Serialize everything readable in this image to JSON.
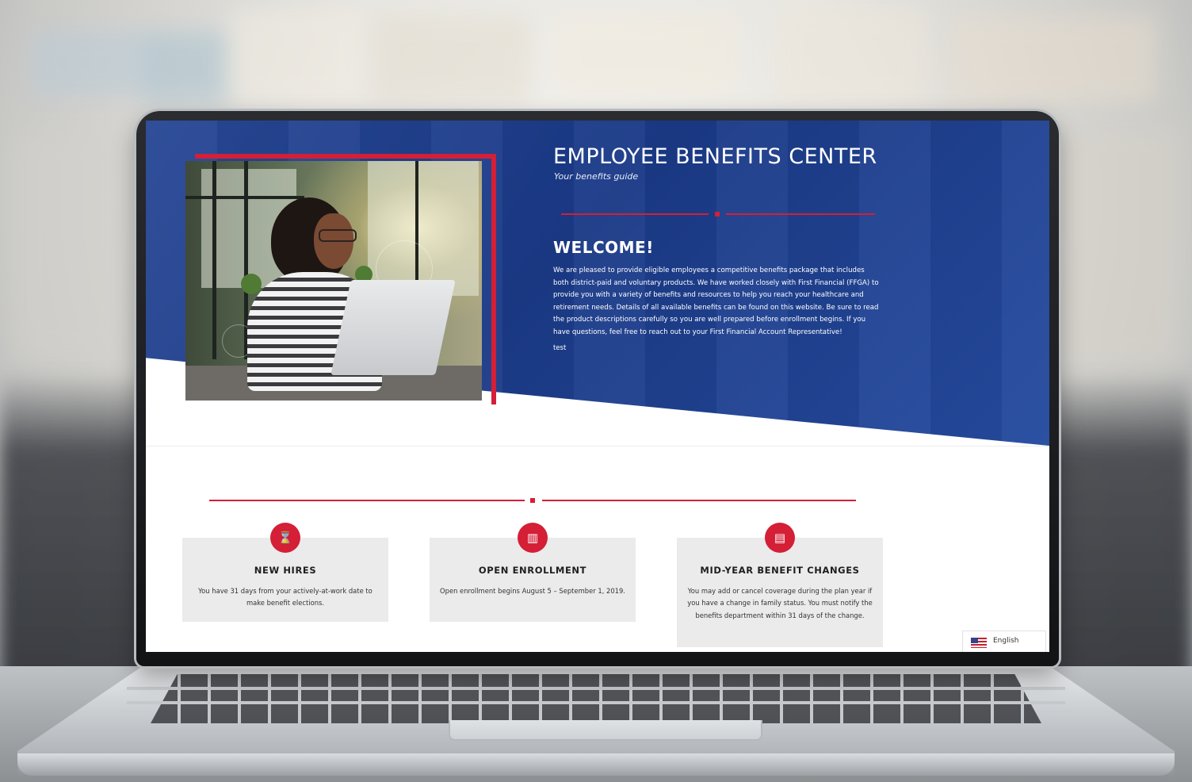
{
  "hero": {
    "title": "EMPLOYEE BENEFITS CENTER",
    "subtitle": "Your benefits guide",
    "welcome_heading": "WELCOME!",
    "welcome_body": "We are pleased to provide eligible employees a competitive benefits package that includes both district-paid and voluntary products. We have worked closely with First Financial (FFGA) to provide you with a variety of benefits and resources to help you reach your healthcare and retirement needs. Details of all available benefits can be found on this website. Be sure to read the product descriptions carefully so you are well prepared before enrollment begins. If you have questions, feel free to reach out to your First Financial Account Representative!",
    "extra_text": "test"
  },
  "cards": [
    {
      "icon": "hourglass-icon",
      "title": "NEW HIRES",
      "body": "You have 31 days from your actively-at-work date to make benefit elections."
    },
    {
      "icon": "book-icon",
      "title": "OPEN ENROLLMENT",
      "body": "Open enrollment begins August 5 – September 1, 2019."
    },
    {
      "icon": "document-icon",
      "title": "MID-YEAR BENEFIT CHANGES",
      "body": "You may add or cancel coverage during the plan year if you have a change in family status. You must notify the benefits department within 31 days of the change."
    }
  ],
  "language": {
    "label": "English",
    "flag": "us-flag-icon"
  },
  "colors": {
    "brand_blue": "#1d3e90",
    "accent_red": "#d41f36",
    "card_bg": "#ebebeb"
  }
}
